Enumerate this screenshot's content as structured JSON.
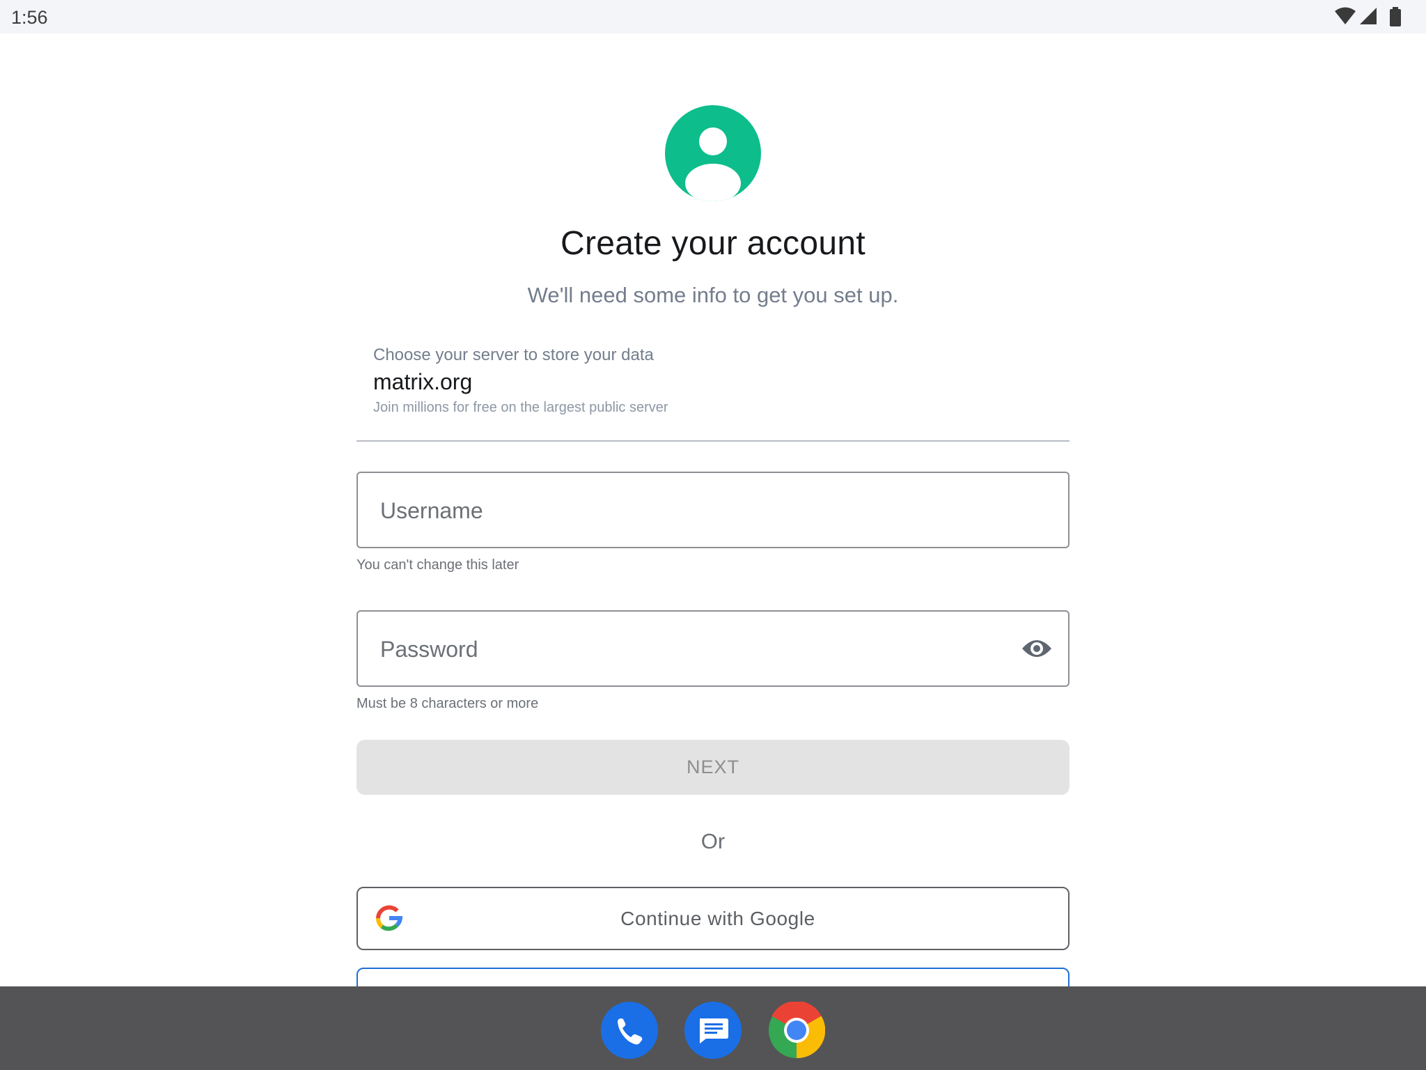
{
  "status_bar": {
    "time": "1:56",
    "icons": [
      "wifi-icon",
      "cell-signal-icon",
      "battery-icon"
    ]
  },
  "header": {
    "avatar_icon": "account-circle-icon",
    "title": "Create your account",
    "subtitle": "We'll need some info to get you set up."
  },
  "server": {
    "label": "Choose your server to store your data",
    "value": "matrix.org",
    "description": "Join millions for free on the largest public server"
  },
  "username": {
    "placeholder": "Username",
    "value": "",
    "helper": "You can't change this later"
  },
  "password": {
    "placeholder": "Password",
    "value": "",
    "helper": "Must be 8 characters or more",
    "toggle_icon": "eye-icon"
  },
  "actions": {
    "next_label": "NEXT",
    "or_label": "Or",
    "google_label": "Continue with Google"
  },
  "dock": {
    "apps": [
      "phone-icon",
      "messages-icon",
      "chrome-icon"
    ]
  },
  "colors": {
    "accent": "#0dbd8b",
    "next_disabled_bg": "#e3e3e3",
    "sso_border": "#1f6fd6",
    "navbar": "#545456"
  }
}
